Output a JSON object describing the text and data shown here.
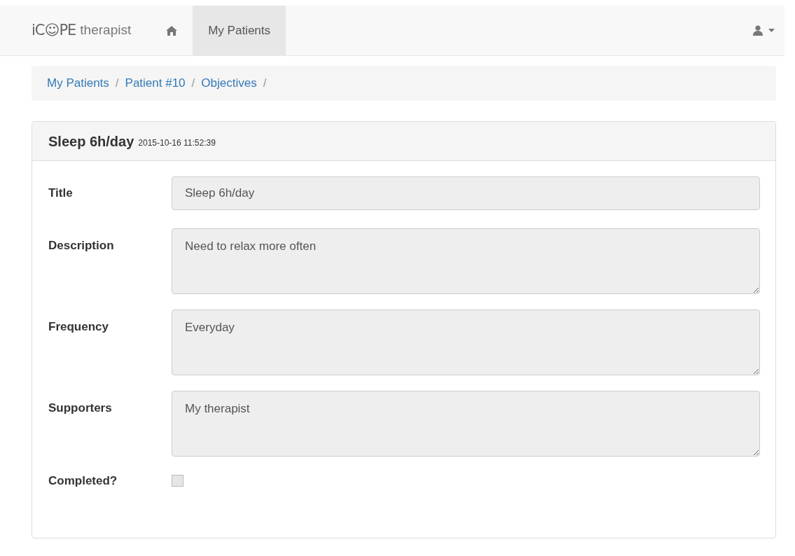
{
  "navbar": {
    "brand": "iC☺PE",
    "brand_suffix": "therapist",
    "items": [
      {
        "kind": "home",
        "selected": false
      },
      {
        "kind": "text",
        "label": "My Patients",
        "selected": true
      }
    ]
  },
  "breadcrumb": {
    "separator": "/",
    "items": [
      "My Patients",
      "Patient #10",
      "Objectives"
    ]
  },
  "panel": {
    "title": "Sleep 6h/day",
    "timestamp": "2015-10-16 11:52:39",
    "fields": [
      {
        "kind": "input",
        "label": "Title",
        "value": "Sleep 6h/day"
      },
      {
        "kind": "textarea",
        "label": "Description",
        "value": "Need to relax more often"
      },
      {
        "kind": "textarea",
        "label": "Frequency",
        "value": "Everyday"
      },
      {
        "kind": "textarea",
        "label": "Supporters",
        "value": "My therapist"
      },
      {
        "kind": "checkbox",
        "label": "Completed?",
        "checked": false
      }
    ]
  }
}
